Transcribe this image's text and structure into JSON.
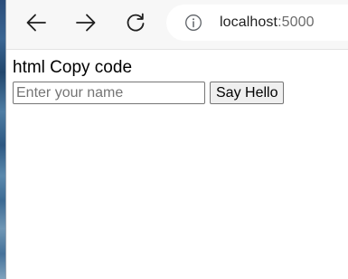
{
  "browser": {
    "address": {
      "host": "localhost",
      "port": ":5000"
    },
    "icons": {
      "back": "arrow-left-icon",
      "forward": "arrow-right-icon",
      "refresh": "refresh-icon",
      "site_info": "info-icon"
    }
  },
  "page": {
    "heading": "html Copy code",
    "name_input": {
      "placeholder": "Enter your name",
      "value": ""
    },
    "say_hello_label": "Say Hello"
  }
}
